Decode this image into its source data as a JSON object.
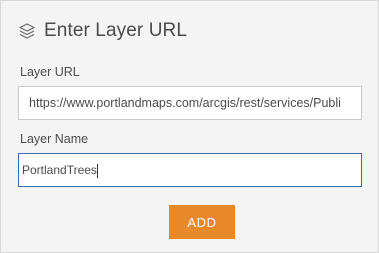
{
  "header": {
    "icon": "layers-icon",
    "title": "Enter Layer URL"
  },
  "form": {
    "url_label": "Layer URL",
    "url_value": "https://www.portlandmaps.com/arcgis/rest/services/Publi",
    "name_label": "Layer Name",
    "name_value": "PortlandTrees",
    "add_label": "ADD"
  },
  "colors": {
    "accent": "#e8892b",
    "focus_border": "#3a6ea5",
    "panel_bg": "#f4f4f4"
  }
}
